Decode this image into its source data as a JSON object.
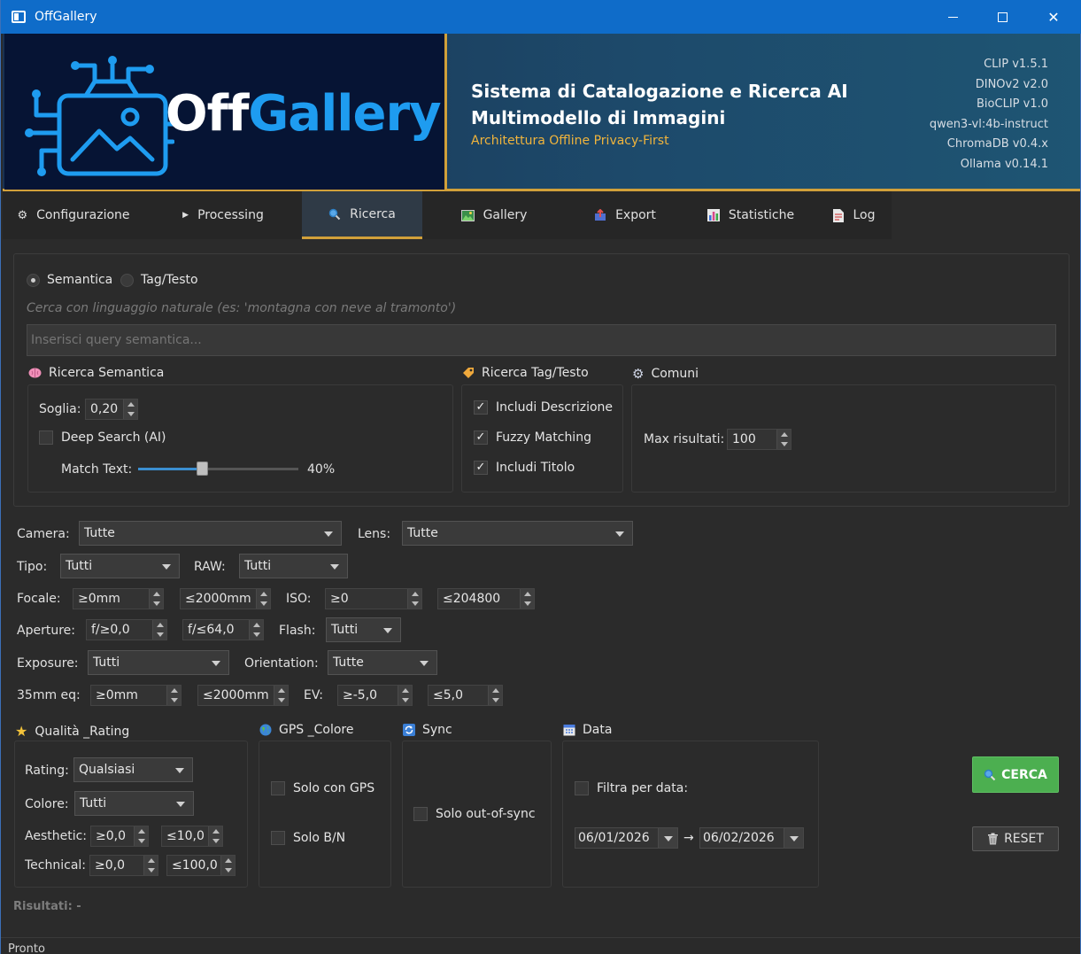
{
  "window": {
    "title": "OffGallery"
  },
  "header": {
    "logo_off": "Off",
    "logo_gallery": "Gallery",
    "title_line1": "Sistema di Catalogazione e Ricerca AI",
    "title_line2": "Multimodello di Immagini",
    "subtitle": "Architettura Offline Privacy-First",
    "versions": [
      "CLIP v1.5.1",
      "DINOv2 v2.0",
      "BioCLIP v1.0",
      "qwen3-vl:4b-instruct",
      "ChromaDB v0.4.x",
      "Ollama v0.14.1"
    ]
  },
  "tabs": [
    {
      "label": "Configurazione",
      "icon": "gear-icon"
    },
    {
      "label": "Processing",
      "icon": "play-icon"
    },
    {
      "label": "Ricerca",
      "icon": "search-icon",
      "active": true
    },
    {
      "label": "Gallery",
      "icon": "image-icon"
    },
    {
      "label": "Export",
      "icon": "export-icon"
    },
    {
      "label": "Statistiche",
      "icon": "chart-icon"
    },
    {
      "label": "Log",
      "icon": "document-icon"
    }
  ],
  "search": {
    "mode_semantic": "Semantica",
    "mode_tag": "Tag/Testo",
    "hint": "Cerca con linguaggio naturale (es: 'montagna con neve al tramonto')",
    "query_placeholder": "Inserisci query semantica...",
    "semantic_group": {
      "title": "Ricerca Semantica",
      "threshold_label": "Soglia:",
      "threshold_value": "0,20",
      "deep_search_label": "Deep Search (AI)",
      "match_text_label": "Match Text:",
      "match_text_value": "40%",
      "match_text_fraction": 0.4
    },
    "tag_group": {
      "title": "Ricerca Tag/Testo",
      "include_description": "Includi Descrizione",
      "fuzzy_matching": "Fuzzy Matching",
      "include_title": "Includi Titolo"
    },
    "common_group": {
      "title": "Comuni",
      "max_results_label": "Max risultati:",
      "max_results_value": "100"
    }
  },
  "filters": {
    "camera_label": "Camera:",
    "camera_value": "Tutte",
    "lens_label": "Lens:",
    "lens_value": "Tutte",
    "tipo_label": "Tipo:",
    "tipo_value": "Tutti",
    "raw_label": "RAW:",
    "raw_value": "Tutti",
    "focale_label": "Focale:",
    "focale_min": "≥0mm",
    "focale_max": "≤2000mm",
    "iso_label": "ISO:",
    "iso_min": "≥0",
    "iso_max": "≤204800",
    "aperture_label": "Aperture:",
    "aperture_min": "f/≥0,0",
    "aperture_max": "f/≤64,0",
    "flash_label": "Flash:",
    "flash_value": "Tutti",
    "exposure_label": "Exposure:",
    "exposure_value": "Tutti",
    "orientation_label": "Orientation:",
    "orientation_value": "Tutte",
    "eq35_label": "35mm eq:",
    "eq35_min": "≥0mm",
    "eq35_max": "≤2000mm",
    "ev_label": "EV:",
    "ev_min": "≥-5,0",
    "ev_max": "≤5,0"
  },
  "quality": {
    "title": "Qualità _Rating",
    "rating_label": "Rating:",
    "rating_value": "Qualsiasi",
    "color_label": "Colore:",
    "color_value": "Tutti",
    "aesthetic_label": "Aesthetic:",
    "aesthetic_min": "≥0,0",
    "aesthetic_max": "≤10,0",
    "technical_label": "Technical:",
    "technical_min": "≥0,0",
    "technical_max": "≤100,0"
  },
  "gps": {
    "title": "GPS _Colore",
    "only_gps": "Solo con GPS",
    "only_bw": "Solo B/N"
  },
  "sync": {
    "title": "Sync",
    "out_of_sync": "Solo out-of-sync"
  },
  "date": {
    "title": "Data",
    "filter_label": "Filtra per data:",
    "from": "06/01/2026",
    "arrow": "→",
    "to": "06/02/2026"
  },
  "actions": {
    "search_label": "CERCA",
    "reset_label": "RESET"
  },
  "results_label": "Risultati: -",
  "status": "Pronto"
}
